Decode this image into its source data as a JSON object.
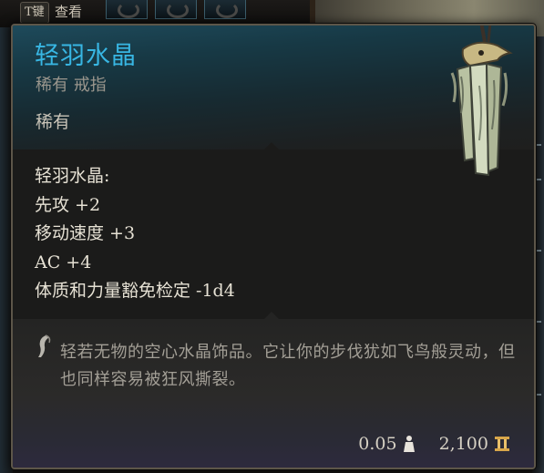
{
  "background": {
    "key_hint": "T键",
    "view_label": "查看"
  },
  "tooltip": {
    "item_name": "轻羽水晶",
    "subtitle": "稀有 戒指",
    "rarity": "稀有",
    "rarity_color": "#38b6e3",
    "properties": [
      "轻羽水晶:",
      "先攻 +2",
      "移动速度 +3",
      "AC +4",
      "体质和力量豁免检定 -1d4"
    ],
    "description_icon": "quill-icon",
    "description": "轻若无物的空心水晶饰品。它让你的步伐犹如飞鸟般灵动，但也同样容易被狂风撕裂。",
    "weight": "0.05",
    "weight_icon": "weight-icon",
    "value": "2,100",
    "value_icon": "gold-coin-icon"
  }
}
